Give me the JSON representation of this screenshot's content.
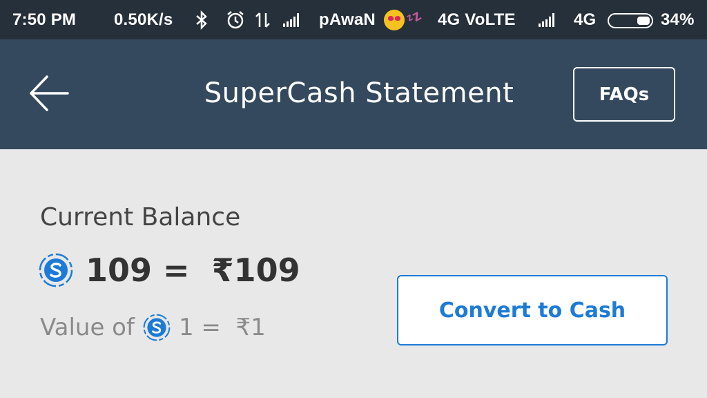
{
  "status_bar": {
    "time": "7:50 PM",
    "net_speed": "0.50K/s",
    "carrier": "pAwaN",
    "network1": "4G VoLTE",
    "network2": "4G",
    "battery_percent": "34%",
    "battery_level": 0.34,
    "icons": [
      "bluetooth-icon",
      "alarm-icon",
      "data-transfer-icon",
      "signal-icon",
      "emoji-icon",
      "signal-icon",
      "battery-icon"
    ]
  },
  "header": {
    "title": "SuperCash Statement",
    "faq_label": "FAQs",
    "back_icon": "back-arrow-icon"
  },
  "balance": {
    "label": "Current Balance",
    "value_text": "109 =  ₹109",
    "rate_prefix": "Value of",
    "rate_value": "1 =  ₹1",
    "currency_icon": "supercash-icon"
  },
  "actions": {
    "convert_label": "Convert to Cash"
  },
  "colors": {
    "status_bar_bg": "#26303a",
    "header_bg": "#34495d",
    "content_bg": "#e8e8e8",
    "accent": "#1c7bd6"
  }
}
